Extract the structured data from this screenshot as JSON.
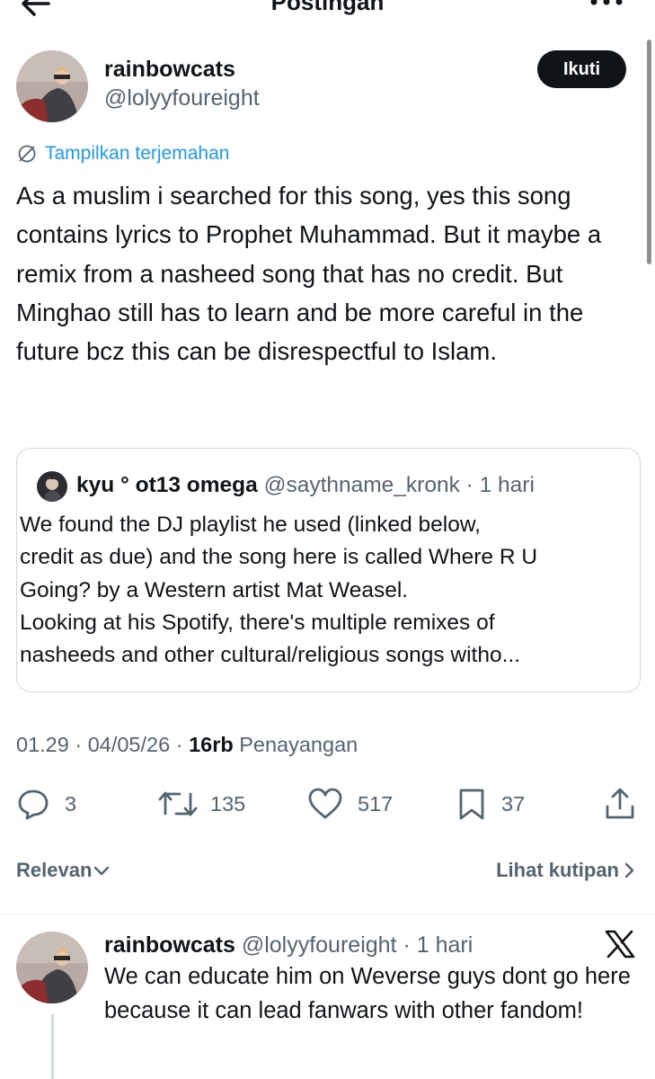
{
  "header": {
    "title": "Postingan",
    "back_icon": "back-arrow-icon",
    "more_icon": "more-icon"
  },
  "post": {
    "author": {
      "display_name": "rainbowcats",
      "handle": "@lolyyfoureight"
    },
    "follow_label": "Ikuti",
    "translate_label": "Tampilkan terjemahan",
    "text": "As a muslim i searched for this song, yes this song contains lyrics to Prophet Muhammad. But it maybe a remix from a nasheed song that has no credit. But Minghao still has to learn and be more careful in the future bcz this can be disrespectful to Islam."
  },
  "quote": {
    "name": "kyu ° ot13 omega",
    "meta": "@saythname_kronk · 1 hari",
    "lines": [
      "We found the DJ playlist he used (linked below,",
      "credit as due) and the song here is called Where R U",
      "Going? by a Western artist Mat Weasel.",
      "Looking at his Spotify, there's multiple remixes of",
      "nasheeds and other cultural/religious songs witho..."
    ]
  },
  "meta": {
    "time": "01.29 · 04/05/26 · ",
    "views": "16rb",
    "views_label": " Penayangan"
  },
  "actions": {
    "replies": "3",
    "reposts": "135",
    "likes": "517",
    "bookmarks": "37"
  },
  "sort": {
    "relevance_label": "Relevan",
    "quotes_label": "Lihat kutipan"
  },
  "reply": {
    "display_name": "rainbowcats",
    "meta": " @lolyyfoureight · 1 hari",
    "text": "We can educate him on Weverse guys dont go here because it can lead fanwars with other fandom!"
  },
  "colors": {
    "accent": "#1d9bf0",
    "text": "#0f1419",
    "secondary": "#536471",
    "border": "#cfd9de"
  }
}
